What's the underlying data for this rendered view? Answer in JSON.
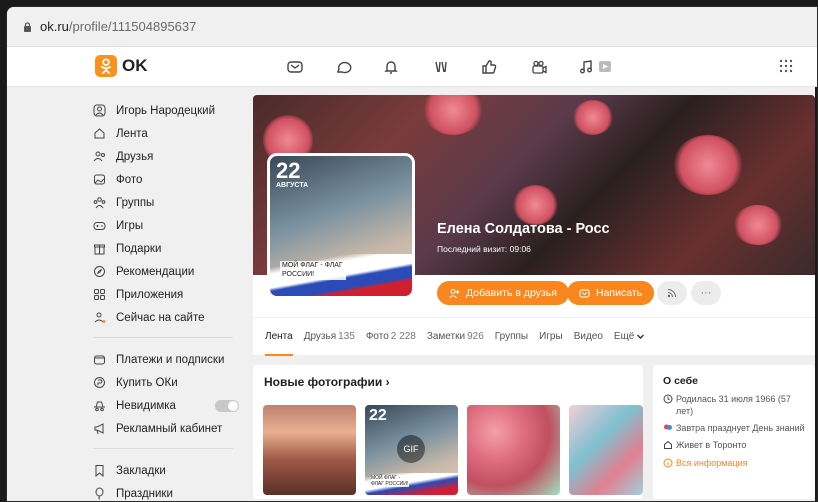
{
  "browser": {
    "url_domain": "ok.ru",
    "url_path": "/profile/111504895637"
  },
  "header": {
    "logo_text": "OK",
    "accent": "#f7931e"
  },
  "sidebar": {
    "items": [
      {
        "label": "Игорь Народецкий",
        "icon": "user-icon"
      },
      {
        "label": "Лента",
        "icon": "home-icon"
      },
      {
        "label": "Друзья",
        "icon": "friends-icon"
      },
      {
        "label": "Фото",
        "icon": "photo-icon"
      },
      {
        "label": "Группы",
        "icon": "groups-icon"
      },
      {
        "label": "Игры",
        "icon": "gamepad-icon"
      },
      {
        "label": "Подарки",
        "icon": "gift-icon"
      },
      {
        "label": "Рекомендации",
        "icon": "compass-icon"
      },
      {
        "label": "Приложения",
        "icon": "apps-icon"
      },
      {
        "label": "Сейчас на сайте",
        "icon": "online-icon"
      }
    ],
    "items2": [
      {
        "label": "Платежи и подписки",
        "icon": "wallet-icon"
      },
      {
        "label": "Купить ОКи",
        "icon": "coin-icon"
      },
      {
        "label": "Невидимка",
        "icon": "incognito-icon"
      },
      {
        "label": "Рекламный кабинет",
        "icon": "megaphone-icon"
      }
    ],
    "items3": [
      {
        "label": "Закладки",
        "icon": "bookmark-icon"
      },
      {
        "label": "Праздники",
        "icon": "balloon-icon"
      }
    ]
  },
  "profile": {
    "name": "Елена Солдатова - Росс",
    "last_visit": "Последний визит: 09:06",
    "avatar_day": "22",
    "avatar_month": "АВГУСТА",
    "avatar_caption": "МОЙ ФЛАГ - ФЛАГ РОССИИ!",
    "add_friend": "Добавить в друзья",
    "write": "Написать",
    "more": "···"
  },
  "tabs": [
    {
      "label": "Лента",
      "count": ""
    },
    {
      "label": "Друзья",
      "count": "135"
    },
    {
      "label": "Фото",
      "count": "2 228"
    },
    {
      "label": "Заметки",
      "count": "926"
    },
    {
      "label": "Группы",
      "count": ""
    },
    {
      "label": "Игры",
      "count": ""
    },
    {
      "label": "Видео",
      "count": ""
    },
    {
      "label": "Ещё",
      "count": ""
    }
  ],
  "photos": {
    "title": "Новые фотографии",
    "gif_label": "GIF",
    "thumb2_day": "22",
    "thumb2_caption": "МОЙ ФЛАГ - ФЛАГ РОССИИ!"
  },
  "about": {
    "title": "О себе",
    "born": "Родилась 31 июля 1966 (57 лет)",
    "holiday": "Завтра празднует День знаний",
    "lives": "Живет в Торонто",
    "all": "Вся информация"
  }
}
